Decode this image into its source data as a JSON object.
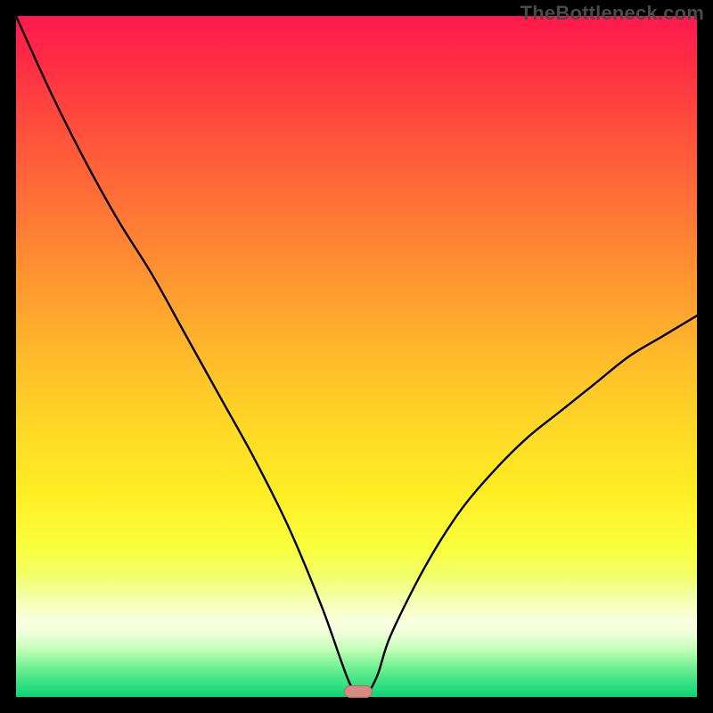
{
  "watermark": "TheBottleneck.com",
  "chart_data": {
    "type": "line",
    "title": "",
    "xlabel": "",
    "ylabel": "",
    "xlim": [
      0,
      100
    ],
    "ylim": [
      0,
      100
    ],
    "x": [
      0,
      5,
      10,
      15,
      20,
      25,
      30,
      35,
      40,
      45,
      49,
      51,
      53,
      55,
      60,
      65,
      70,
      75,
      80,
      85,
      90,
      95,
      100
    ],
    "y": [
      100,
      89,
      79,
      70,
      62,
      53,
      44,
      35,
      25,
      13,
      2,
      0,
      3,
      9,
      19,
      27,
      33,
      38,
      42,
      46,
      50,
      53,
      56
    ],
    "series": [
      {
        "name": "bottleneck-curve",
        "x_ref": "x",
        "y_ref": "y"
      }
    ],
    "marker": {
      "x": 50.3,
      "y": 0.5,
      "label": ""
    },
    "background_gradient": {
      "top": "#ff1a4d",
      "mid": "#ffee24",
      "bottom": "#0fd176"
    }
  }
}
